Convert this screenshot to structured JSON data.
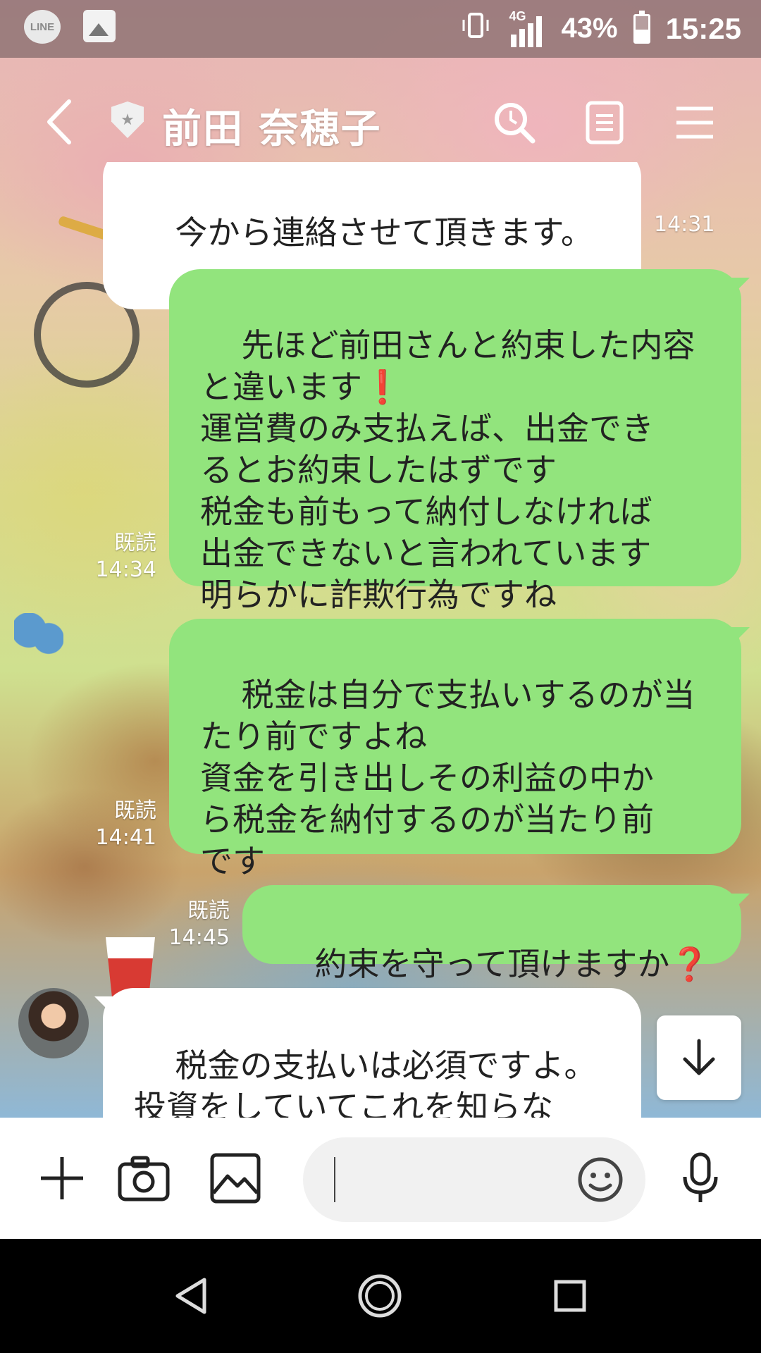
{
  "status_bar": {
    "left_icons": [
      "line-notification-icon",
      "gallery-notification-icon"
    ],
    "line_badge_text": "LINE",
    "network": "4G",
    "battery_percent": "43%",
    "battery_level": 0.43,
    "time": "15:25"
  },
  "header": {
    "title": "前田 奈穂子",
    "back_icon": "chevron-left-icon",
    "verified_icon": "shield-star-icon",
    "actions": [
      "search-icon",
      "notes-icon",
      "menu-icon"
    ]
  },
  "messages": [
    {
      "direction": "in",
      "text": "今から連絡させて頂きます。",
      "time": "14:31"
    },
    {
      "direction": "out",
      "text": "先ほど前田さんと約束した内容\nと違います❗\n運営費のみ支払えば、出金でき\nるとお約束したはずです\n税金も前もって納付しなければ\n出金できないと言われています\n明らかに詐欺行為ですね",
      "read": "既読",
      "time": "14:34"
    },
    {
      "direction": "out",
      "text": "税金は自分で支払いするのが当\nたり前ですよね\n資金を引き出しその利益の中か\nら税金を納付するのが当たり前\nです",
      "read": "既読",
      "time": "14:41"
    },
    {
      "direction": "out",
      "text": "約束を守って頂けますか❓",
      "read": "既読",
      "time": "14:45"
    },
    {
      "direction": "in",
      "text": "税金の支払いは必須ですよ。\n投資をしていてこれを知らな\nいのですか？詐欺だと言うの",
      "time": ""
    }
  ],
  "input_bar": {
    "placeholder": "",
    "value": "",
    "icons": [
      "plus-icon",
      "camera-icon",
      "image-icon",
      "emoji-icon",
      "microphone-icon"
    ]
  },
  "nav_bar": {
    "icons": [
      "nav-back-icon",
      "nav-home-icon",
      "nav-recents-icon"
    ]
  }
}
